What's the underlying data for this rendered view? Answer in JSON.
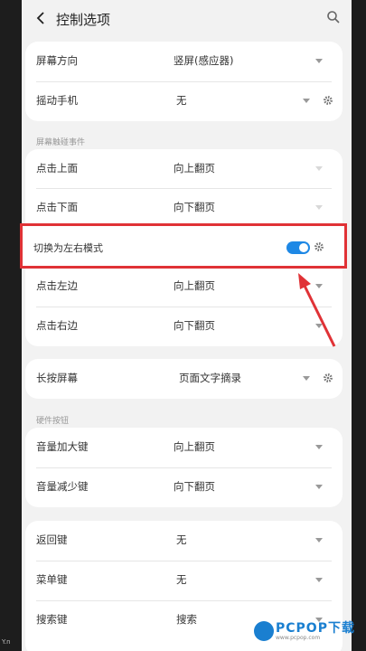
{
  "header": {
    "title": "控制选项"
  },
  "screen": {
    "orientation_label": "屏幕方向",
    "orientation_value": "竖屏(感应器)",
    "shake_label": "摇动手机",
    "shake_value": "无"
  },
  "touch": {
    "section_title": "屏幕触碰事件",
    "rows": [
      {
        "label": "点击上面",
        "value": "向上翻页"
      },
      {
        "label": "点击下面",
        "value": "向下翻页"
      },
      {
        "label": "切换为左右模式",
        "value": ""
      },
      {
        "label": "点击左边",
        "value": "向上翻页"
      },
      {
        "label": "点击右边",
        "value": "向下翻页"
      }
    ],
    "toggle_on": true
  },
  "longpress": {
    "label": "长按屏幕",
    "value": "页面文字摘录"
  },
  "hardware": {
    "section_title": "硬件按钮",
    "rows": [
      {
        "label": "音量加大键",
        "value": "向上翻页"
      },
      {
        "label": "音量减少键",
        "value": "向下翻页"
      }
    ]
  },
  "keys": {
    "rows": [
      {
        "label": "返回键",
        "value": "无"
      },
      {
        "label": "菜单键",
        "value": "无"
      },
      {
        "label": "搜索键",
        "value": "搜索"
      }
    ]
  },
  "watermark": {
    "brand": "PCPOP下载",
    "sub": "www.pcpop.com"
  },
  "colors": {
    "accent": "#1e88e5",
    "highlight": "#e03236"
  }
}
